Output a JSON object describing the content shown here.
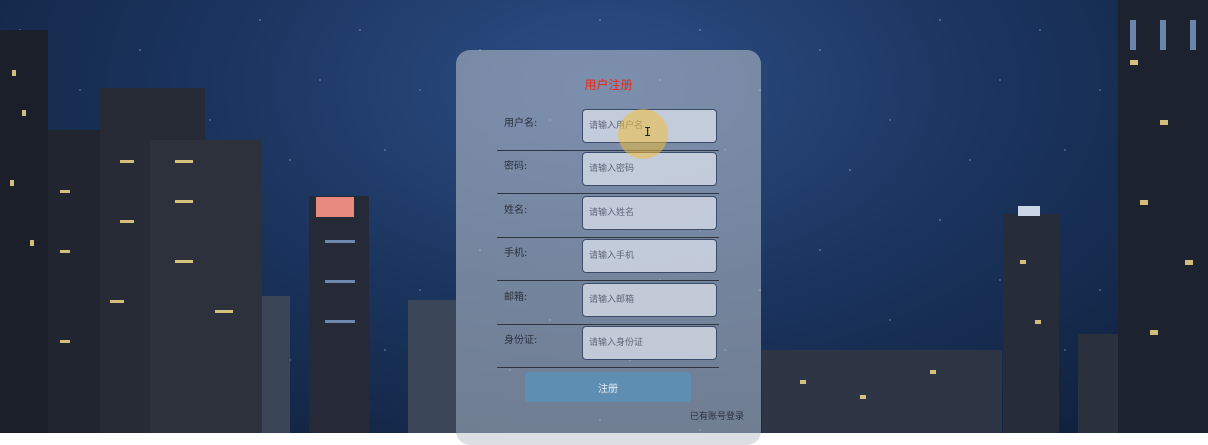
{
  "form": {
    "title": "用户注册",
    "fields": [
      {
        "label": "用户名:",
        "placeholder": "请输入用户名",
        "value": ""
      },
      {
        "label": "密码:",
        "placeholder": "请输入密码",
        "value": ""
      },
      {
        "label": "姓名:",
        "placeholder": "请输入姓名",
        "value": ""
      },
      {
        "label": "手机:",
        "placeholder": "请输入手机",
        "value": ""
      },
      {
        "label": "邮箱:",
        "placeholder": "请输入邮箱",
        "value": ""
      },
      {
        "label": "身份证:",
        "placeholder": "请输入身份证",
        "value": ""
      }
    ],
    "submit_label": "注册",
    "login_link": "已有账号登录"
  },
  "colors": {
    "title": "#e8261a",
    "button": "#5e8fb2",
    "card": "#bec4ce",
    "cursor_highlight": "#eebe3c"
  },
  "icons": {
    "cursor": "text-cursor-icon"
  }
}
